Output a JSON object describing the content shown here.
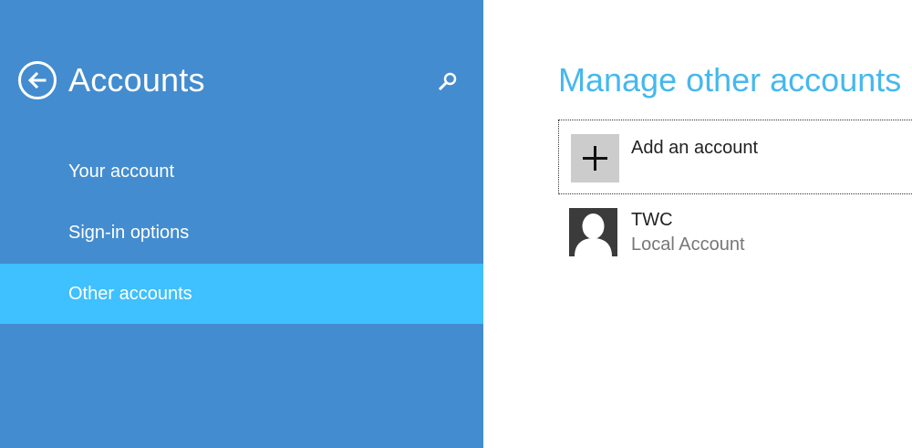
{
  "sidebar": {
    "title": "Accounts",
    "back_icon": "back-arrow-icon",
    "search_icon": "search-icon",
    "background": "#438ccf",
    "selected_background": "#3fc0ff",
    "items": [
      {
        "label": "Your account",
        "selected": false
      },
      {
        "label": "Sign-in options",
        "selected": false
      },
      {
        "label": "Other accounts",
        "selected": true
      }
    ]
  },
  "main": {
    "title": "Manage other accounts",
    "title_color": "#45b8ee",
    "add_account": {
      "label": "Add an account",
      "icon": "plus-icon"
    },
    "accounts": [
      {
        "name": "TWC",
        "type": "Local Account",
        "icon": "user-avatar-icon"
      }
    ]
  }
}
